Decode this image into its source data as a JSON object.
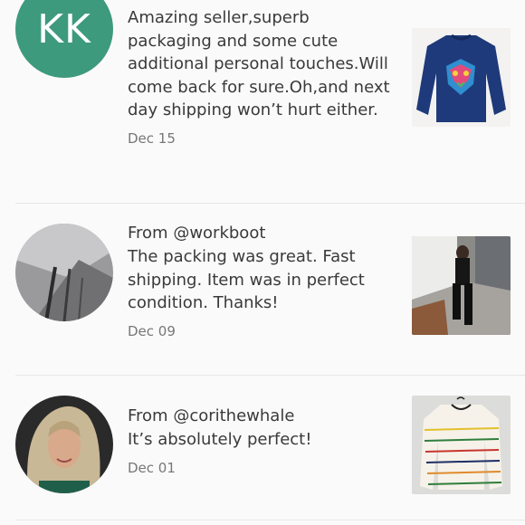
{
  "reviews": [
    {
      "avatar_initials": "KK",
      "avatar_color": "#3d9a7d",
      "from": "",
      "text": "Amazing seller,superb packaging and some cute additional personal touches.Will come back for sure.Oh,and next day shipping won’t hurt either.",
      "date": "Dec 15"
    },
    {
      "from": "From @workboot",
      "text": "The packing was great. Fast shipping. Item was in perfect condition. Thanks!",
      "date": "Dec 09"
    },
    {
      "from": "From @corithewhale",
      "text": "It’s absolutely perfect!",
      "date": "Dec 01"
    }
  ]
}
